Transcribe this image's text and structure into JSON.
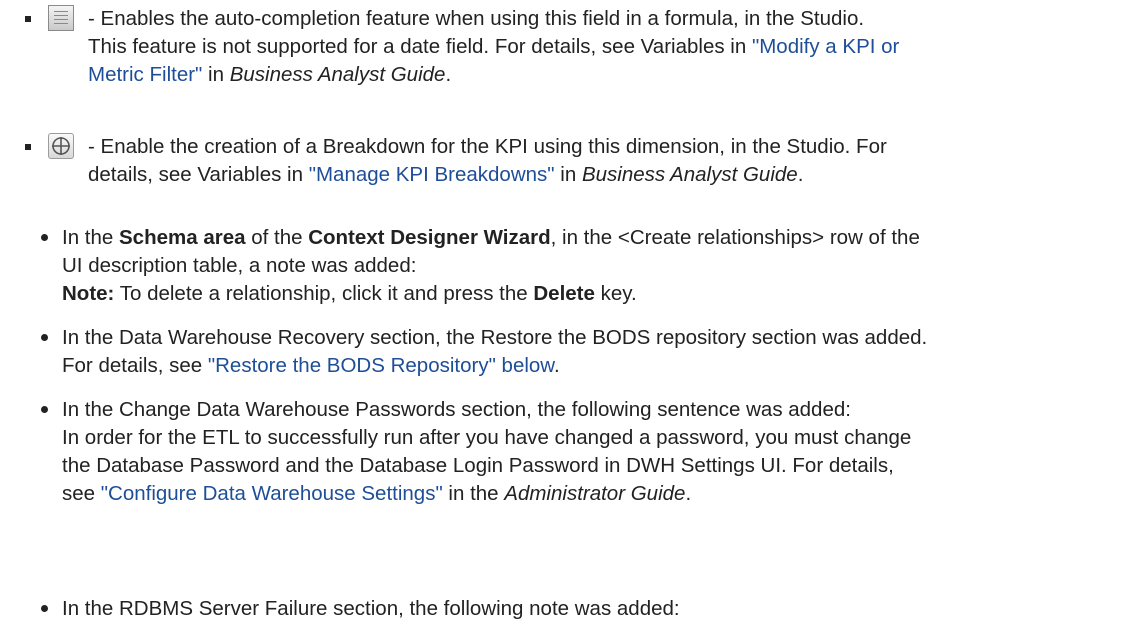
{
  "sub_items": [
    {
      "icon": "auto-completion-icon",
      "line1": "- Enables the auto-completion feature when using this field in a formula, in the Studio.",
      "line2a": "This feature is not supported for a date field. For details, see Variables in ",
      "link_a": "\"Modify a KPI or",
      "link_b": "Metric Filter\"",
      "line3b": " in ",
      "guide": "Business Analyst Guide",
      "period": "."
    },
    {
      "icon": "breakdown-icon",
      "line1": "- Enable the creation of a Breakdown for the KPI using this dimension, in the Studio. For",
      "line2a": "details, see Variables in ",
      "link": "\"Manage KPI Breakdowns\"",
      "line2b": " in ",
      "guide": "Business Analyst Guide",
      "period": "."
    }
  ],
  "items": [
    {
      "l1_a": "In the ",
      "l1_b1": "Schema area",
      "l1_c": " of the ",
      "l1_b2": "Context Designer Wizard",
      "l1_d": ", in the <Create relationships> row of the",
      "l2": "UI description table, a note was added:",
      "note_label": "Note:",
      "note_a": " To delete a relationship, click it and press the ",
      "note_b": "Delete",
      "note_c": " key."
    },
    {
      "l1": "In the Data Warehouse Recovery section, the Restore the BODS repository section was added.",
      "l2a": "For details, see ",
      "link": "\"Restore the BODS Repository\" below",
      "period": "."
    },
    {
      "l1": "In the Change Data Warehouse Passwords section, the following sentence was added:",
      "l2": "In order for the ETL to successfully run after you have changed a password, you must change",
      "l3": "the Database Password and the Database Login Password in DWH Settings UI. For details,",
      "l4a": "see ",
      "link": "\"Configure Data Warehouse Settings\"",
      "l4b": " in the ",
      "guide": "Administrator Guide",
      "period": "."
    },
    {
      "l1": "In the RDBMS Server Failure section, the following note was added:"
    }
  ],
  "colors": {
    "link": "#1e4e97",
    "text": "#222222"
  }
}
